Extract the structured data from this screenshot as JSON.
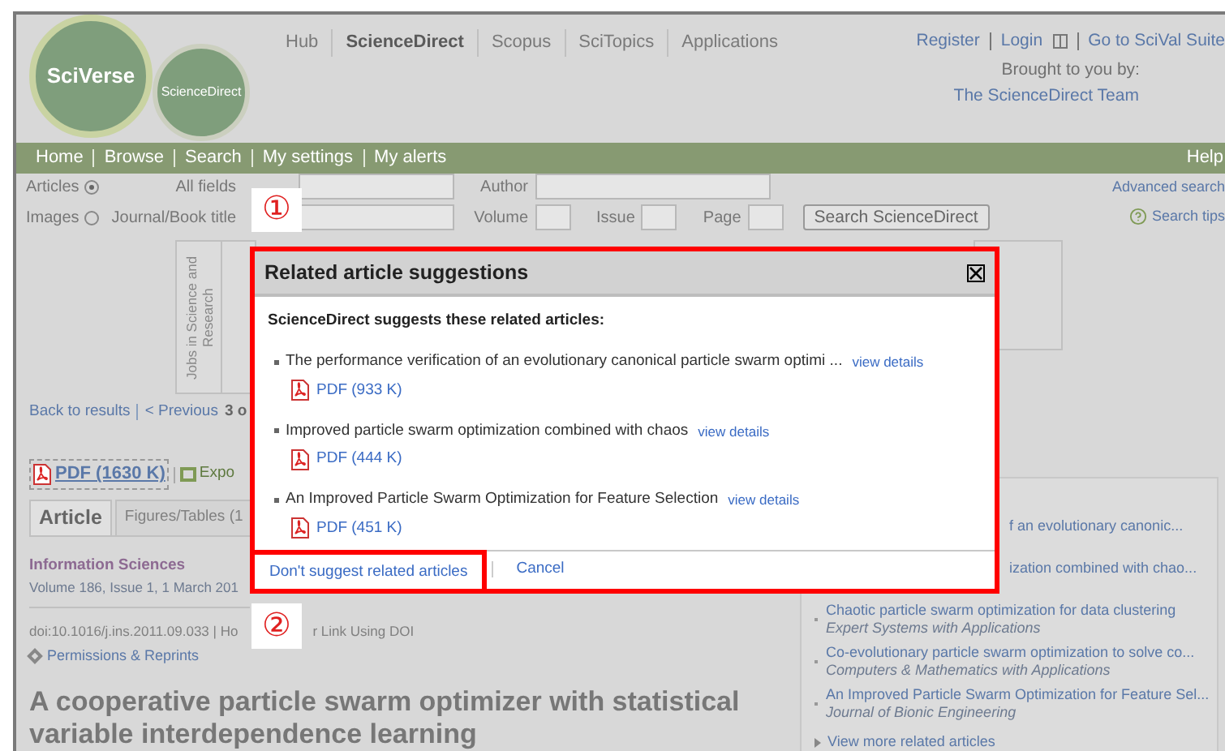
{
  "header": {
    "logo_primary": "SciVerse",
    "logo_secondary": "ScienceDirect",
    "nav": [
      {
        "label": "Hub",
        "selected": false
      },
      {
        "label": "ScienceDirect",
        "selected": true
      },
      {
        "label": "Scopus",
        "selected": false
      },
      {
        "label": "SciTopics",
        "selected": false
      },
      {
        "label": "Applications",
        "selected": false
      }
    ],
    "account_links": [
      "Register",
      "Login",
      "Go to SciVal Suite"
    ],
    "brought_by": "Brought to you by:",
    "team": "The ScienceDirect Team"
  },
  "main_nav": {
    "items": [
      "Home",
      "Browse",
      "Search",
      "My settings",
      "My alerts"
    ],
    "help": "Help"
  },
  "search": {
    "types": [
      {
        "label": "Articles",
        "selected": true
      },
      {
        "label": "Images",
        "selected": false
      }
    ],
    "all_fields": "All fields",
    "journal": "Journal/Book title",
    "author": "Author",
    "volume": "Volume",
    "issue": "Issue",
    "page": "Page",
    "button": "Search ScienceDirect",
    "advanced": "Advanced search",
    "tips": "Search tips"
  },
  "jobs_banner": "Jobs in Science and Research",
  "article_nav": {
    "back": "Back to results",
    "previous": "< Previous",
    "position": "3 o"
  },
  "article_actions": {
    "pdf": "PDF (1630 K)",
    "export": "Expo"
  },
  "tabs": [
    {
      "label": "Article",
      "selected": true
    },
    {
      "label": "Figures/Tables (1",
      "selected": false
    }
  ],
  "article": {
    "journal": "Information Sciences",
    "volume": "Volume 186, Issue 1, 1 March 201",
    "doi": "doi:10.1016/j.ins.2011.09.033 | Ho",
    "doi_rest": "r Link Using DOI",
    "permissions": "Permissions & Reprints",
    "title": "A cooperative particle swarm optimizer with statistical variable interdependence learning"
  },
  "related_panel": {
    "items": [
      {
        "title": "f an evolutionary canonic..."
      },
      {
        "title": "ization combined with chao..."
      },
      {
        "title": "Chaotic particle swarm optimization for data clustering",
        "journal": "Expert Systems with Applications"
      },
      {
        "title": "Co-evolutionary particle swarm optimization to solve co...",
        "journal": "Computers & Mathematics with Applications"
      },
      {
        "title": "An Improved Particle Swarm Optimization for Feature Sel...",
        "journal": "Journal of Bionic Engineering"
      }
    ],
    "more": "View more related articles"
  },
  "dialog": {
    "title": "Related article suggestions",
    "intro": "ScienceDirect suggests these related articles:",
    "articles": [
      {
        "title": "The performance verification of an evolutionary canonical particle swarm optimi ...",
        "details": "view details",
        "pdf": "PDF (933 K)"
      },
      {
        "title": "Improved particle swarm optimization combined with chaos",
        "details": "view details",
        "pdf": "PDF (444 K)"
      },
      {
        "title": "An Improved Particle Swarm Optimization for Feature Selection",
        "details": "view details",
        "pdf": "PDF (451 K)"
      }
    ],
    "dont_suggest": "Don't suggest related articles",
    "cancel": "Cancel"
  },
  "annotations": [
    "①",
    "②"
  ]
}
